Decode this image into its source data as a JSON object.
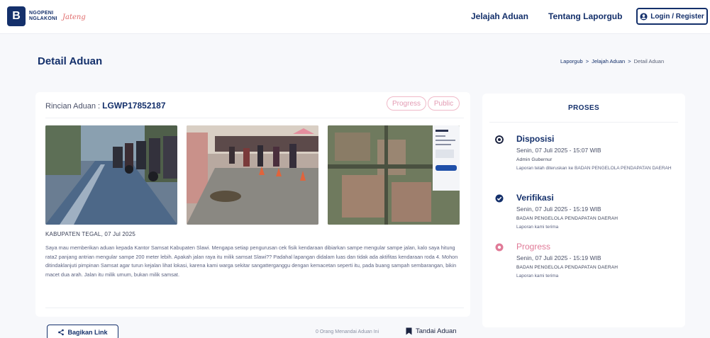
{
  "header": {
    "logo_mark": "B",
    "logo_line1": "NGOPENI",
    "logo_line2": "NGLAKONI",
    "logo_script": "Jateng",
    "nav": [
      "Jelajah Aduan",
      "Tentang Laporgub"
    ],
    "login_label": "Login / Register"
  },
  "page": {
    "title": "Detail Aduan",
    "breadcrumb": [
      "Laporgub",
      "Jelajah Aduan",
      "Detail Aduan"
    ],
    "breadcrumb_sep": ">"
  },
  "report": {
    "label": "Rincian Aduan : ",
    "code": "LGWP17852187",
    "badges": [
      "Progress",
      "Public"
    ],
    "location": "KABUPATEN TEGAL, 07 Jul 2025",
    "description": "Saya mau memberikan aduan kepada Kantor Samsat Kabupaten Slawi. Mengapa setiap pengurusan cek fisik kendaraan dibiarkan sampe mengular sampe jalan, kalo saya hitung rata2 panjang antrian mengular sampe 200 meter lebih. Apakah jalan raya itu milik samsat Slawi?? Padahal lapangan didalam luas dan tidak ada aktifitas kendaraan roda 4. Mohon ditindaklanjuti pimpinan Samsat agar turun kejalan lihat lokasi, karena kami warga sekitar sangatterganggu dengan kemacetan seperti itu, pada buang sampah sembarangan, bikin macet dua arah. Jalan itu milik umum, bukan milik samsat.",
    "share_label": "Bagikan Link",
    "mark_count_text": "0 Orang Menandai Aduan Ini",
    "mark_label": "Tandai Aduan"
  },
  "process": {
    "title": "PROSES",
    "steps": [
      {
        "title": "Disposisi",
        "time": "Senin, 07 Juli 2025 - 15:07 WIB",
        "actor": "Admin Gubernur",
        "note": "Laporan telah diteruskan ke BADAN PENGELOLA PENDAPATAN DAERAH",
        "status_color": "#1b2340"
      },
      {
        "title": "Verifikasi",
        "time": "Senin, 07 Juli 2025 - 15:19 WIB",
        "actor": "BADAN PENGELOLA PENDAPATAN DAERAH",
        "note": "Laporan kami terima",
        "status_color": "#14306b"
      },
      {
        "title": "Progress",
        "time": "Senin, 07 Juli 2025 - 15:19 WIB",
        "actor": "BADAN PENGELOLA PENDAPATAN DAERAH",
        "note": "Laporan kami terima",
        "status_color": "#e07a97"
      }
    ]
  },
  "colors": {
    "brand": "#14306b",
    "progress_pink": "#e07a97",
    "badge_pink": "#e39bb3"
  }
}
